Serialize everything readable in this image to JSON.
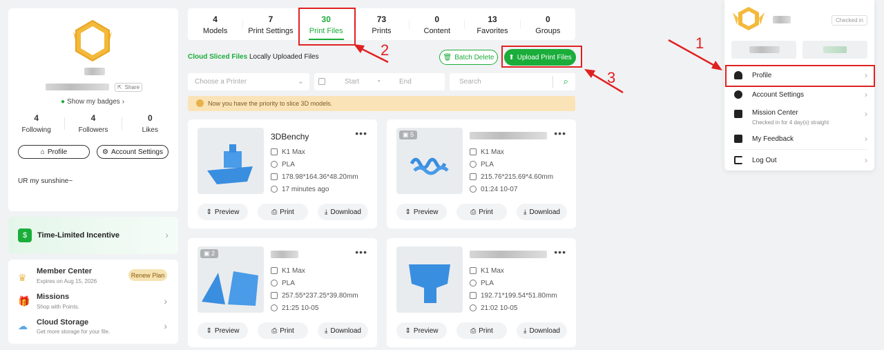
{
  "profile": {
    "show_badges": "Show my badges",
    "share": "Share",
    "stats": [
      {
        "value": "4",
        "label": "Following"
      },
      {
        "value": "4",
        "label": "Followers"
      },
      {
        "value": "0",
        "label": "Likes"
      }
    ],
    "profile_btn": "Profile",
    "account_btn": "Account Settings",
    "bio": "UR my sunshine~"
  },
  "incentive": {
    "label": "Time-Limited Incentive"
  },
  "member": {
    "title": "Member Center",
    "expires": "Expires on Aug 15, 2026",
    "renew": "Renew Plan",
    "missions_title": "Missions",
    "missions_sub": "Shop with Points.",
    "cloud_title": "Cloud Storage",
    "cloud_sub": "Get more storage for your file."
  },
  "tabs": [
    {
      "count": "4",
      "label": "Models"
    },
    {
      "count": "7",
      "label": "Print Settings"
    },
    {
      "count": "30",
      "label": "Print Files"
    },
    {
      "count": "73",
      "label": "Prints"
    },
    {
      "count": "0",
      "label": "Content"
    },
    {
      "count": "13",
      "label": "Favorites"
    },
    {
      "count": "0",
      "label": "Groups"
    }
  ],
  "subtabs": {
    "cloud": "Cloud Sliced Files",
    "local": "Locally Uploaded Files"
  },
  "actions": {
    "batch_delete": "Batch Delete",
    "upload": "Upload Print Files"
  },
  "filters": {
    "printer_placeholder": "Choose a Printer",
    "start": "Start",
    "dash": "-",
    "end": "End",
    "search_placeholder": "Search"
  },
  "notice": "Now you have the priority to slice 3D models.",
  "files": [
    {
      "title": "3DBenchy",
      "printer": "K1 Max",
      "material": "PLA",
      "size": "178.98*164.36*48.20mm",
      "time": "17 minutes ago",
      "stack": ""
    },
    {
      "title": "",
      "printer": "K1 Max",
      "material": "PLA",
      "size": "215.76*215.69*4.60mm",
      "time": "01:24 10-07",
      "stack": "5"
    },
    {
      "title": "",
      "printer": "K1 Max",
      "material": "PLA",
      "size": "257.55*237.25*39.80mm",
      "time": "21:25 10-05",
      "stack": "2"
    },
    {
      "title": "",
      "printer": "K1 Max",
      "material": "PLA",
      "size": "192.71*199.54*51.80mm",
      "time": "21:02 10-05",
      "stack": ""
    }
  ],
  "card_buttons": {
    "preview": "Preview",
    "print": "Print",
    "download": "Download"
  },
  "dropdown": {
    "checked_in": "Checked in",
    "items": [
      {
        "label": "Profile",
        "sub": ""
      },
      {
        "label": "Account Settings",
        "sub": ""
      },
      {
        "label": "Mission Center",
        "sub": "Checked in for 4 day(s) straight"
      },
      {
        "label": "My Feedback",
        "sub": ""
      },
      {
        "label": "Log Out",
        "sub": ""
      }
    ]
  },
  "annotations": [
    "1",
    "2",
    "3"
  ],
  "colors": {
    "accent": "#1aad3a",
    "annotation": "#e02020",
    "notice_bg": "#fbe3b8"
  }
}
